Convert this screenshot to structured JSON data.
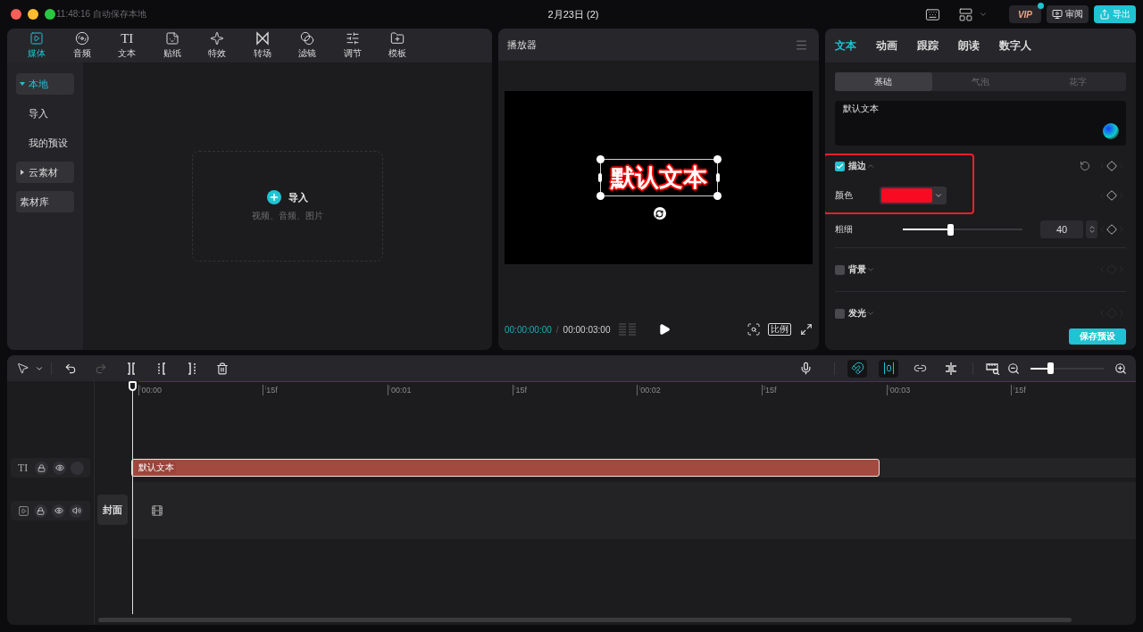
{
  "title_bar": {
    "autosave": "11:48:16 自动保存本地",
    "title": "2月23日 (2)",
    "vip": "VIP",
    "review": "审阅",
    "export": "导出"
  },
  "media_panel": {
    "tabs": [
      {
        "kind": "media",
        "label": "媒体",
        "selected": true
      },
      {
        "kind": "audio",
        "label": "音频",
        "selected": false
      },
      {
        "kind": "text",
        "icon_text": "TI",
        "label": "文本",
        "selected": false
      },
      {
        "kind": "sticker",
        "label": "贴纸",
        "selected": false
      },
      {
        "kind": "effect",
        "label": "特效",
        "selected": false
      },
      {
        "kind": "transition",
        "label": "转场",
        "selected": false
      },
      {
        "kind": "filter",
        "label": "滤镜",
        "selected": false
      },
      {
        "kind": "adjust",
        "label": "调节",
        "selected": false
      },
      {
        "kind": "template",
        "label": "模板",
        "selected": false
      }
    ],
    "sidebar": [
      {
        "kind": "group",
        "label": "本地",
        "expanded": true,
        "selected": true
      },
      {
        "kind": "item",
        "label": "导入",
        "selected": false
      },
      {
        "kind": "item",
        "label": "我的预设",
        "selected": false
      },
      {
        "kind": "group",
        "label": "云素材",
        "expanded": false,
        "selected": false
      },
      {
        "kind": "button",
        "label": "素材库",
        "selected": false
      }
    ],
    "import": {
      "label": "导入",
      "hint": "视频、音频、图片"
    }
  },
  "player": {
    "title": "播放器",
    "canvas_text": "默认文本",
    "current_time": "00:00:00:00",
    "time_separator": "/",
    "total_time": "00:00:03:00",
    "ratio": "比例"
  },
  "inspector": {
    "tabs": [
      {
        "label": "文本",
        "selected": true
      },
      {
        "label": "动画",
        "selected": false
      },
      {
        "label": "跟踪",
        "selected": false
      },
      {
        "label": "朗读",
        "selected": false
      },
      {
        "label": "数字人",
        "selected": false
      }
    ],
    "subtabs": [
      {
        "label": "基础",
        "selected": true
      },
      {
        "label": "气泡",
        "selected": false
      },
      {
        "label": "花字",
        "selected": false
      }
    ],
    "text_value": "默认文本",
    "stroke": {
      "label": "描边",
      "checked": true,
      "expanded": true,
      "highlighted": true,
      "color_label": "颜色",
      "color": "#f70a22"
    },
    "thickness": {
      "label": "粗细",
      "level": 0.4,
      "value": "40"
    },
    "toggles": [
      {
        "label": "背景",
        "checked": false,
        "expanded": false
      },
      {
        "label": "发光",
        "checked": false,
        "expanded": false
      }
    ],
    "save_button": "保存预设"
  },
  "timeline": {
    "tools": [
      {
        "kind": "undo",
        "disabled": false
      },
      {
        "kind": "redo",
        "disabled": true
      }
    ],
    "toggles": [
      {
        "kind": "main-track-magnet",
        "on": true
      },
      {
        "kind": "auto-snap",
        "on": true
      },
      {
        "kind": "linkage",
        "on": false
      },
      {
        "kind": "preview-axis",
        "on": false
      }
    ],
    "zoom": {
      "level": 0.28
    },
    "ruler": [
      "00:00",
      "15f",
      "00:01",
      "15f",
      "00:02",
      "15f",
      "00:03",
      "15f"
    ],
    "tracks": [
      {
        "kind": "text",
        "icon_text": "TI",
        "clip": "默认文本"
      },
      {
        "kind": "video",
        "cover": "封面"
      }
    ]
  }
}
